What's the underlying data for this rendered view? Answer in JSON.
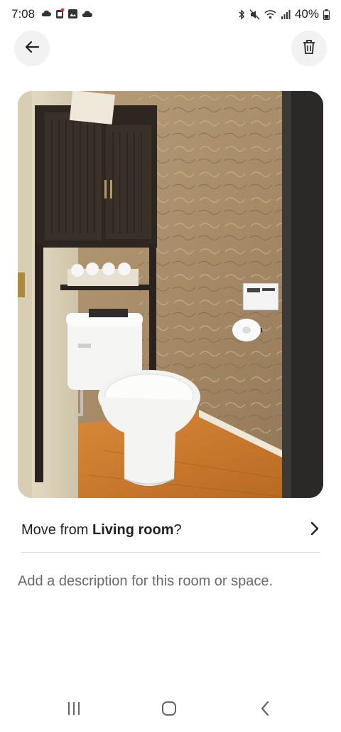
{
  "status_bar": {
    "time": "7:08",
    "battery": "40%",
    "left_icons": [
      "cloud-sync-icon",
      "notification-badge-icon",
      "gallery-icon",
      "cloud-icon"
    ],
    "right_icons": [
      "bluetooth-icon",
      "mute-icon",
      "wifi-icon",
      "signal-icon",
      "battery-icon"
    ]
  },
  "toolbar": {
    "back_icon": "arrow-left-icon",
    "delete_icon": "trash-icon"
  },
  "photo": {
    "subject": "bathroom-photo"
  },
  "move_row": {
    "prefix": "Move from ",
    "room": "Living room",
    "suffix": "?",
    "chevron_icon": "chevron-right-icon"
  },
  "description": {
    "placeholder": "Add a description for this room or space.",
    "value": ""
  },
  "nav_bar": {
    "icons": [
      "recents-icon",
      "home-icon",
      "back-icon"
    ]
  },
  "colors": {
    "text": "#222222",
    "divider": "#dddddd",
    "button_bg": "#f2f2f2"
  }
}
